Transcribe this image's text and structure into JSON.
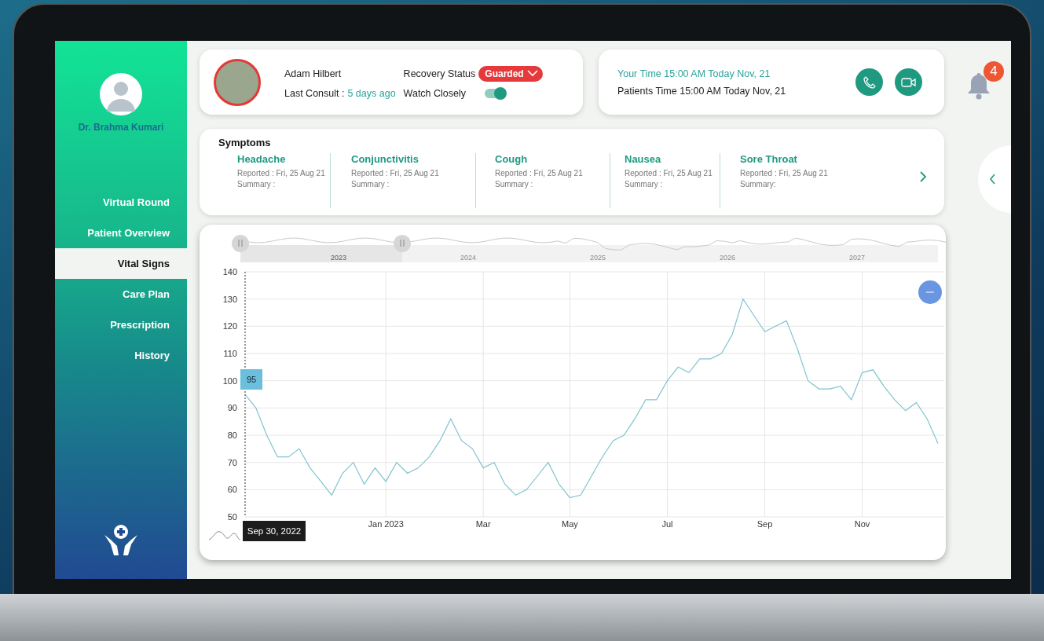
{
  "doctor": {
    "name": "Dr. Brahma Kumari"
  },
  "nav": [
    {
      "label": "Virtual Round",
      "selected": false
    },
    {
      "label": "Patient Overview",
      "selected": false
    },
    {
      "label": "Vital Signs",
      "selected": true
    },
    {
      "label": "Care Plan",
      "selected": false
    },
    {
      "label": "Prescription",
      "selected": false
    },
    {
      "label": "History",
      "selected": false
    }
  ],
  "patient": {
    "name": "Adam Hilbert",
    "last_consult_label": "Last Consult :",
    "last_consult": "5 days ago",
    "recovery_status_label": "Recovery Status",
    "recovery_status": "Guarded",
    "watch_closely_label": "Watch Closely",
    "watch_closely": true
  },
  "times": {
    "your_time": "Your Time 15:00 AM Today Nov, 21",
    "patients_time": "Patients Time 15:00 AM Today Nov, 21"
  },
  "notifications": {
    "count": "4"
  },
  "symptoms": {
    "title": "Symptoms",
    "items": [
      {
        "name": "Headache",
        "reported": "Reported : Fri, 25 Aug 21",
        "summary": "Summary :"
      },
      {
        "name": "Conjunctivitis",
        "reported": "Reported : Fri, 25 Aug 21",
        "summary": "Summary :"
      },
      {
        "name": "Cough",
        "reported": "Reported : Fri, 25 Aug 21",
        "summary": "Summary :"
      },
      {
        "name": "Nausea",
        "reported": "Reported : Fri, 25 Aug 21",
        "summary": "Summary :"
      },
      {
        "name": "Sore Throat",
        "reported": "Reported : Fri, 25 Aug 21",
        "summary": "Summary:"
      }
    ]
  },
  "vitals": {
    "navigator_years": [
      "2023",
      "2024",
      "2025",
      "2026",
      "2027"
    ],
    "tooltip_value": "95",
    "tooltip_date": "Sep 30, 2022",
    "chart_data": {
      "type": "line",
      "categories": [
        null,
        null,
        null,
        null,
        null,
        null,
        null,
        null,
        null,
        null,
        null,
        null,
        null,
        "Jan 2023",
        null,
        null,
        null,
        null,
        null,
        null,
        null,
        null,
        "Mar",
        null,
        null,
        null,
        null,
        null,
        null,
        null,
        "May",
        null,
        null,
        null,
        null,
        null,
        null,
        null,
        null,
        "Jul",
        null,
        null,
        null,
        null,
        null,
        null,
        null,
        null,
        "Sep",
        null,
        null,
        null,
        null,
        null,
        null,
        null,
        null,
        "Nov",
        null,
        null,
        null,
        null,
        null,
        null,
        null
      ],
      "values": [
        95,
        90,
        80,
        72,
        72,
        75,
        68,
        63,
        58,
        66,
        70,
        62,
        68,
        63,
        70,
        66,
        68,
        72,
        78,
        86,
        78,
        75,
        68,
        70,
        62,
        58,
        60,
        65,
        70,
        62,
        57,
        58,
        65,
        72,
        78,
        80,
        86,
        93,
        93,
        100,
        105,
        103,
        108,
        108,
        110,
        117,
        130,
        124,
        118,
        120,
        122,
        112,
        100,
        97,
        97,
        98,
        93,
        103,
        104,
        98,
        93,
        89,
        92,
        86,
        77
      ],
      "ylim": [
        50,
        140
      ],
      "grid": true,
      "yticks": [
        50,
        60,
        70,
        80,
        90,
        100,
        110,
        120,
        130,
        140
      ]
    }
  }
}
